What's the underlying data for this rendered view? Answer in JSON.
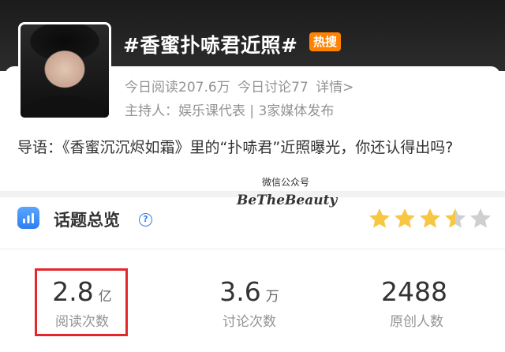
{
  "topic": {
    "title": "#香蜜扑哧君近照#",
    "badge": "热搜",
    "stats": {
      "reads_today": "今日阅读207.6万",
      "discussions_today": "今日讨论77",
      "details_link": "详情>"
    },
    "host_line": "主持人：娱乐课代表 | 3家媒体发布"
  },
  "intro_text": "导语：《香蜜沉沉烬如霜》里的“扑哧君”近照曝光，你还认得出吗?",
  "watermark": {
    "line1": "微信公众号",
    "line2": "BeTheBeauty"
  },
  "overview": {
    "title": "话题总览",
    "help_glyph": "?",
    "rating": 3.5,
    "max_rating": 5,
    "colors": {
      "star_on": "#f7c744",
      "star_off": "#cfcfcf"
    }
  },
  "metrics": [
    {
      "value": "2.8",
      "unit": "亿",
      "label": "阅读次数"
    },
    {
      "value": "3.6",
      "unit": "万",
      "label": "讨论次数"
    },
    {
      "value": "2488",
      "unit": "",
      "label": "原创人数"
    }
  ],
  "colors": {
    "hot_badge": "#ff8200",
    "accent_blue": "#2f7ff0",
    "highlight_red": "#e3272b"
  }
}
